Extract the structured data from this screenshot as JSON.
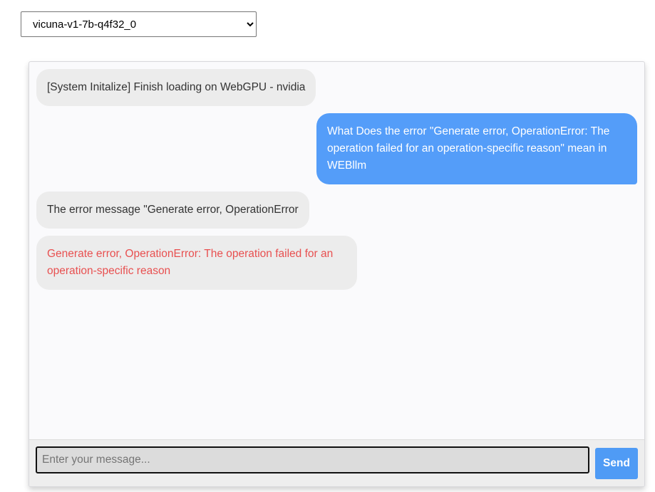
{
  "model_select": {
    "selected": "vicuna-v1-7b-q4f32_0"
  },
  "chat": {
    "messages": [
      {
        "role": "bot",
        "text": "[System Initalize] Finish loading on WebGPU - nvidia"
      },
      {
        "role": "user",
        "text": "What Does the error \"Generate error, OperationError: The operation failed for an operation-specific reason\" mean in WEBllm"
      },
      {
        "role": "bot",
        "text": "The error message \"Generate error, OperationError"
      },
      {
        "role": "error",
        "text": "Generate error, OperationError: The operation failed for an operation-specific reason"
      }
    ]
  },
  "input": {
    "placeholder": "Enter your message...",
    "value": ""
  },
  "send_label": "Send",
  "colors": {
    "user_bubble": "#549df9",
    "bot_bubble": "#ececec",
    "error_text": "#e85050",
    "send_button": "#4f9bf5"
  }
}
